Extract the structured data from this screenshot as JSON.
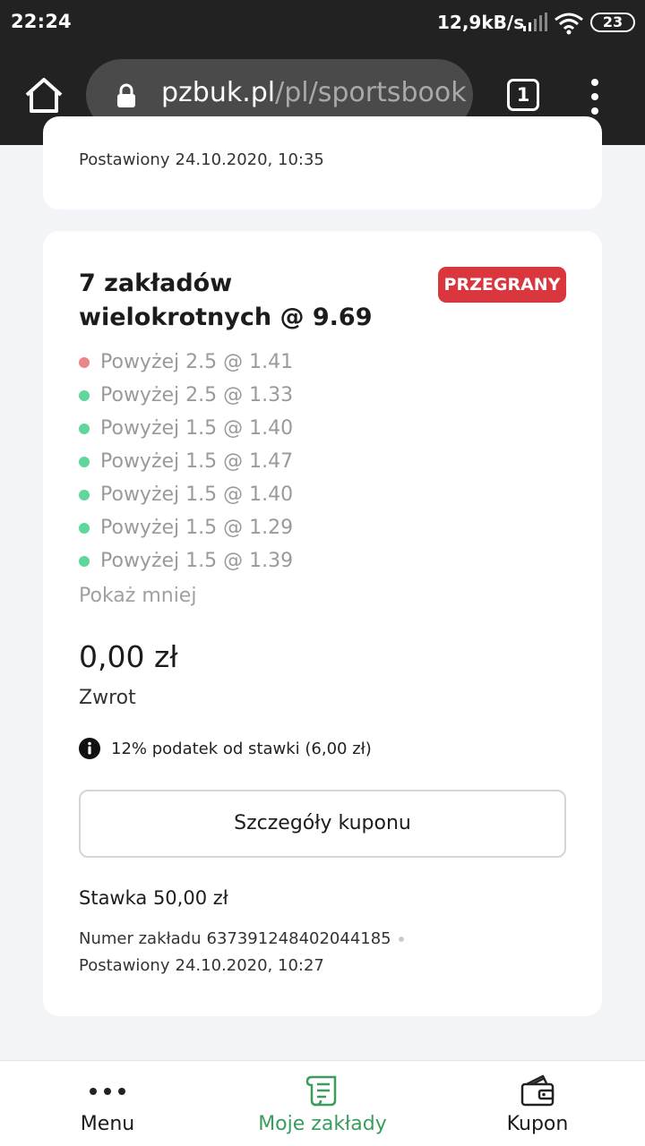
{
  "status_bar": {
    "time": "22:24",
    "net_speed": "12,9kB/s",
    "battery": "23",
    "icons": [
      "signal-icon",
      "wifi-icon",
      "battery-icon"
    ]
  },
  "browser": {
    "url_host": "pzbuk.pl",
    "url_path": "/pl/sportsbook",
    "tab_count": "1",
    "icons": [
      "home-icon",
      "lock-icon",
      "overflow-menu-icon"
    ]
  },
  "previous_bet": {
    "placed_label": "Postawiony",
    "placed_value": "24.10.2020, 10:35"
  },
  "bet": {
    "title": "7 zakładów wielokrotnych @ 9.69",
    "status": "PRZEGRANY",
    "legs": [
      {
        "text": "Powyżej 2.5 @ 1.41",
        "result": "lost"
      },
      {
        "text": "Powyżej 2.5 @ 1.33",
        "result": "won"
      },
      {
        "text": "Powyżej 1.5 @ 1.40",
        "result": "won"
      },
      {
        "text": "Powyżej 1.5 @ 1.47",
        "result": "won"
      },
      {
        "text": "Powyżej 1.5 @ 1.40",
        "result": "won"
      },
      {
        "text": "Powyżej 1.5 @ 1.29",
        "result": "won"
      },
      {
        "text": "Powyżej 1.5 @ 1.39",
        "result": "won"
      }
    ],
    "show_less": "Pokaż mniej",
    "payout_value": "0,00 zł",
    "payout_label": "Zwrot",
    "tax_note": "12% podatek od stawki (6,00 zł)",
    "details_button": "Szczegóły kuponu",
    "stake": "Stawka 50,00 zł",
    "bet_number_label": "Numer zakładu",
    "bet_number_value": "637391248402044185",
    "placed_label": "Postawiony",
    "placed_value": "24.10.2020, 10:27"
  },
  "bottom_nav": {
    "items": [
      {
        "label": "Menu",
        "icon": "more-dots-icon"
      },
      {
        "label": "Moje zakłady",
        "icon": "scroll-receipt-icon",
        "active": true
      },
      {
        "label": "Kupon",
        "icon": "wallet-icon"
      }
    ]
  },
  "colors": {
    "lost": "#e8868a",
    "won": "#5fd69a",
    "badge": "#d9363e",
    "accent_green": "#3a9d5d",
    "chrome_bar": "#222222"
  }
}
